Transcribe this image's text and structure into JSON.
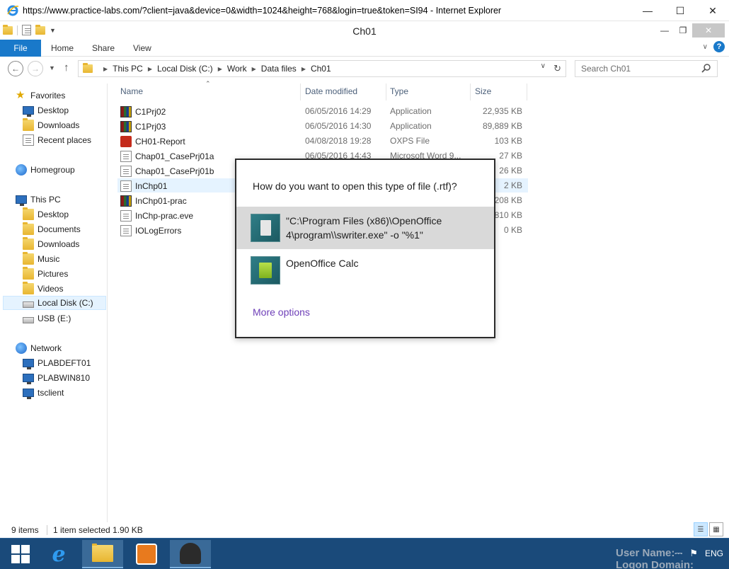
{
  "browser": {
    "title": "https://www.practice-labs.com/?client=java&device=0&width=1024&height=768&login=true&token=SI94 - Internet Explorer"
  },
  "explorer": {
    "caption": "Ch01",
    "ribbon_tabs": [
      "File",
      "Home",
      "Share",
      "View"
    ],
    "breadcrumbs": [
      "This PC",
      "Local Disk (C:)",
      "Work",
      "Data files",
      "Ch01"
    ],
    "search_placeholder": "Search Ch01"
  },
  "navpane": {
    "favorites": {
      "label": "Favorites",
      "items": [
        "Desktop",
        "Downloads",
        "Recent places"
      ]
    },
    "homegroup": "Homegroup",
    "thispc": {
      "label": "This PC",
      "items": [
        "Desktop",
        "Documents",
        "Downloads",
        "Music",
        "Pictures",
        "Videos",
        "Local Disk (C:)",
        "USB (E:)"
      ]
    },
    "network": {
      "label": "Network",
      "items": [
        "PLABDEFT01",
        "PLABWIN810",
        "tsclient"
      ]
    }
  },
  "columns": {
    "name": "Name",
    "date": "Date modified",
    "type": "Type",
    "size": "Size"
  },
  "files": [
    {
      "name": "C1Prj02",
      "date": "06/05/2016 14:29",
      "type": "Application",
      "size": "22,935 KB",
      "icon": "winrar-icon"
    },
    {
      "name": "C1Prj03",
      "date": "06/05/2016 14:30",
      "type": "Application",
      "size": "89,889 KB",
      "icon": "winrar-icon"
    },
    {
      "name": "CH01-Report",
      "date": "04/08/2018 19:28",
      "type": "OXPS File",
      "size": "103 KB",
      "icon": "oxps-icon"
    },
    {
      "name": "Chap01_CasePrj01a",
      "date": "06/05/2016 14:43",
      "type": "Microsoft Word 9...",
      "size": "27 KB",
      "icon": "document-icon"
    },
    {
      "name": "Chap01_CasePrj01b",
      "date": "",
      "type": "",
      "size": "26 KB",
      "icon": "document-icon"
    },
    {
      "name": "InChp01",
      "date": "",
      "type": "",
      "size": "2 KB",
      "icon": "document-icon"
    },
    {
      "name": "InChp01-prac",
      "date": "",
      "type": "",
      "size": "208 KB",
      "icon": "winrar-icon"
    },
    {
      "name": "InChp-prac.eve",
      "date": "",
      "type": "",
      "size": "810 KB",
      "icon": "document-icon"
    },
    {
      "name": "IOLogErrors",
      "date": "",
      "type": "",
      "size": "0 KB",
      "icon": "document-icon"
    }
  ],
  "status": {
    "count": "9 items",
    "selection": "1 item selected  1.90 KB"
  },
  "dialog": {
    "question": "How do you want to open this type of file (.rtf)?",
    "option1": "\"C:\\Program Files (x86)\\OpenOffice 4\\program\\\\swriter.exe\" -o \"%1\"",
    "option2": "OpenOffice Calc",
    "more": "More options"
  },
  "taskbar": {
    "user_line1": "User Name:",
    "user_line2": "Logon Domain:",
    "lang": "ENG"
  }
}
